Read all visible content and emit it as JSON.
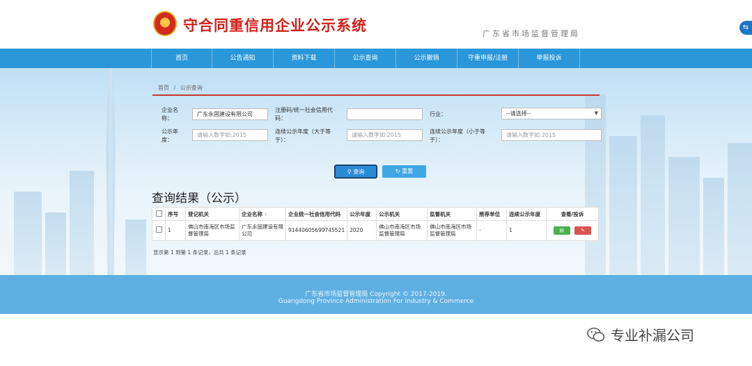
{
  "header": {
    "site_title": "守合同重信用企业公示系统",
    "agency": "广东省市场监督管理局"
  },
  "nav": {
    "items": [
      "首页",
      "公告通知",
      "资料下载",
      "公示查询",
      "公示撤销",
      "守重申报/注册",
      "举报投诉"
    ]
  },
  "breadcrumb": {
    "home": "首页",
    "sep": "/",
    "current": "公示查询"
  },
  "form": {
    "company_name_label": "企业名称：",
    "company_name_value": "广东永固建设有限公司",
    "reg_no_label": "注册码/统一社会信用代码：",
    "reg_no_value": "",
    "industry_label": "行业：",
    "industry_value": "--请选择--",
    "year_label": "公示年度：",
    "year_placeholder": "请输入数字如:2015",
    "consec_gt_label": "连续公示年度（大于等于）：",
    "consec_gt_placeholder": "请输入数字如:2015",
    "consec_lt_label": "连续公示年度（小于等于）：",
    "consec_lt_placeholder": "请输入数字如:2015"
  },
  "buttons": {
    "query": "查询",
    "reset": "重置"
  },
  "results": {
    "title": "查询结果（公示）",
    "columns": [
      "序号",
      "登记机关",
      "企业名称",
      "企业统一社会信用代码",
      "公示年度",
      "公示机关",
      "监督机关",
      "推荐单位",
      "连续公示年度",
      "查看/投诉"
    ],
    "rows": [
      {
        "index": "1",
        "reg_authority": "佛山市南海区市场监督管理局",
        "company": "广东永固建设有限公司",
        "credit_code": "91440605699745521",
        "year": "2020",
        "pub_authority": "佛山市南海区市场监督管理局",
        "sup_authority": "佛山市南海区市场监督管理局",
        "recommender": "-",
        "consecutive": "1"
      }
    ],
    "pager": "显示第 1 到第 1 条记录，总共 1 条记录"
  },
  "footer": {
    "line1": "广东省市场监督管理局 Copyright © 2017-2019.",
    "line2": "Guangdong Province Administration For Industry & Commerce"
  },
  "watermark": {
    "text": "专业补漏公司"
  },
  "colors": {
    "nav_bg": "#2a97d8",
    "title_red": "#d3201a",
    "footer_bg": "#5fb0e2",
    "view_btn": "#48b04c",
    "edit_btn": "#d9534f"
  }
}
